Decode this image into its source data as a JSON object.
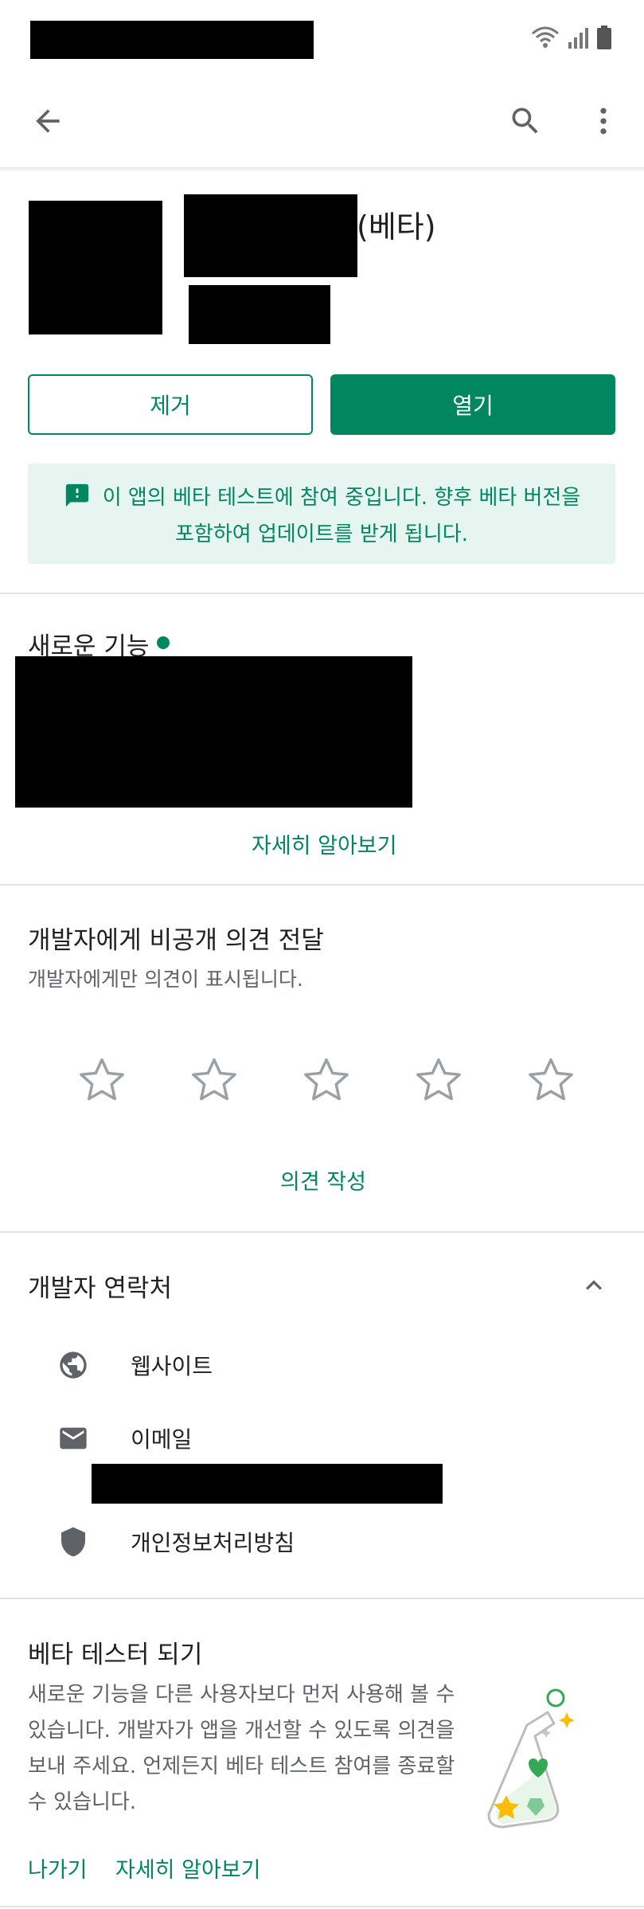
{
  "header": {
    "beta_suffix": "(베타)"
  },
  "actions": {
    "remove_label": "제거",
    "open_label": "열기"
  },
  "beta_banner": {
    "message_line1": "이 앱의 베타 테스트에 참여 중입니다. 향후 베타 버전을",
    "message_line2": "포함하여 업데이트를 받게 됩니다."
  },
  "whats_new": {
    "title": "새로운 기능",
    "learn_more": "자세히 알아보기"
  },
  "feedback": {
    "title": "개발자에게 비공개 의견 전달",
    "subtitle": "개발자에게만 의견이 표시됩니다.",
    "star_count": 5,
    "rating": 0,
    "write_label": "의견 작성"
  },
  "developer_contact": {
    "title": "개발자 연락처",
    "items": [
      {
        "label": "웹사이트",
        "icon": "globe-icon"
      },
      {
        "label": "이메일",
        "icon": "mail-icon"
      },
      {
        "label": "개인정보처리방침",
        "icon": "shield-icon"
      }
    ]
  },
  "beta_tester": {
    "title": "베타 테스터 되기",
    "body": "새로운 기능을 다른 사용자보다 먼저 사용해 볼 수 있습니다. 개발자가 앱을 개선할 수 있도록 의견을 보내 주세요. 언제든지 베타 테스트 참여를 종료할 수 있습니다.",
    "leave_label": "나가기",
    "learn_more": "자세히 알아보기"
  },
  "colors": {
    "accent": "#01875f",
    "banner_bg": "#e6f5f0",
    "divider": "#e3e3e3"
  }
}
